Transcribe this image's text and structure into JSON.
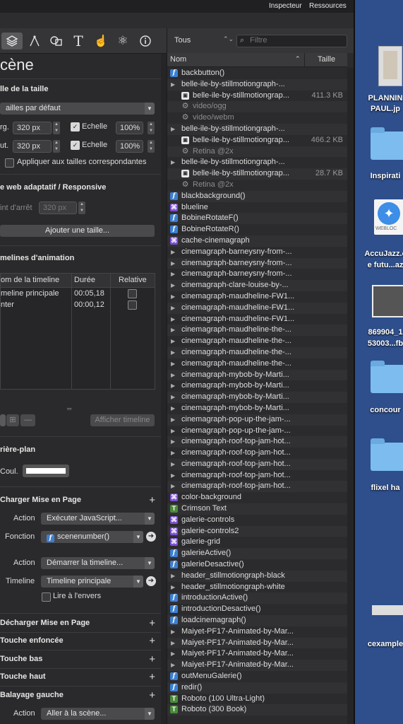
{
  "topbar": {
    "inspector": "Inspecteur",
    "resources": "Ressources"
  },
  "left": {
    "scene_title": "cène",
    "size_section": "lle de la taille",
    "sizes_default": "ailles par défaut",
    "width_label": "rg.",
    "width_value": "320 px",
    "height_label": "ut.",
    "height_value": "320 px",
    "scale_label": "Echelle",
    "scale_value1": "100%",
    "scale_value2": "100%",
    "apply_sizes": "Appliquer aux tailles correspondantes",
    "responsive_section": "e web adaptatif / Responsive",
    "breakpoint_label": "int d'arrêt",
    "breakpoint_value": "320 px",
    "add_size": "Ajouter une taille...",
    "timelines_section": "melines d'animation",
    "tl_cols": {
      "name": "om de la timeline",
      "duration": "Durée",
      "relative": "Relative"
    },
    "tl_rows": [
      {
        "name": "meline principale",
        "duration": "00:05,18"
      },
      {
        "name": "nter",
        "duration": "00:00,12"
      }
    ],
    "show_timeline": "Afficher timeline",
    "background_section": "rière-plan",
    "color_label": "Coul.",
    "load_page": "Charger Mise en Page",
    "action_label": "Action",
    "action1": "Exécuter JavaScript...",
    "function_label": "Fonction",
    "function_value": "scenenumber()",
    "action2": "Démarrer la timeline...",
    "timeline_label": "Timeline",
    "timeline_value": "Timeline principale",
    "reverse_label": "Lire à l'envers",
    "unload_page": "Décharger Mise en Page",
    "key_down": "Touche enfoncée",
    "key_bottom": "Touche bas",
    "key_top": "Touche haut",
    "swipe_left": "Balayage gauche",
    "action3": "Aller à la scène..."
  },
  "right": {
    "filter_dropdown": "Tous",
    "search_placeholder": "Filtre",
    "col_name": "Nom",
    "col_size": "Taille",
    "rows": [
      {
        "icon": "f",
        "name": "backbutton()",
        "indent": 0
      },
      {
        "icon": "tri",
        "name": "belle-ile-by-stillmotiongraph-...",
        "indent": 0
      },
      {
        "icon": "img",
        "name": "belle-ile-by-stillmotiongrap...",
        "size": "411.3 KB",
        "indent": 1
      },
      {
        "icon": "gear",
        "name": "video/ogg",
        "indent": 1,
        "dim": true
      },
      {
        "icon": "gear",
        "name": "video/webm",
        "indent": 1,
        "dim": true
      },
      {
        "icon": "tri",
        "name": "belle-ile-by-stillmotiongraph-...",
        "indent": 0
      },
      {
        "icon": "img",
        "name": "belle-ile-by-stillmotiongrap...",
        "size": "466.2 KB",
        "indent": 1
      },
      {
        "icon": "gear",
        "name": "Retina @2x",
        "indent": 1,
        "dim": true
      },
      {
        "icon": "tri",
        "name": "belle-ile-by-stillmotiongraph-...",
        "indent": 0
      },
      {
        "icon": "img",
        "name": "belle-ile-by-stillmotiongrap...",
        "size": "28.7 KB",
        "indent": 1
      },
      {
        "icon": "gear",
        "name": "Retina @2x",
        "indent": 1,
        "dim": true
      },
      {
        "icon": "f",
        "name": "blackbackground()",
        "indent": 0
      },
      {
        "icon": "c",
        "name": "blueline",
        "indent": 0
      },
      {
        "icon": "f",
        "name": "BobineRotateF()",
        "indent": 0
      },
      {
        "icon": "f",
        "name": "BobineRotateR()",
        "indent": 0
      },
      {
        "icon": "c",
        "name": "cache-cinemagraph",
        "indent": 0
      },
      {
        "icon": "tri",
        "name": "cinemagraph-barneysny-from-...",
        "indent": 0
      },
      {
        "icon": "tri",
        "name": "cinemagraph-barneysny-from-...",
        "indent": 0
      },
      {
        "icon": "tri",
        "name": "cinemagraph-barneysny-from-...",
        "indent": 0
      },
      {
        "icon": "tri",
        "name": "cinemagraph-clare-louise-by-...",
        "indent": 0
      },
      {
        "icon": "tri",
        "name": "cinemagraph-maudheline-FW1...",
        "indent": 0
      },
      {
        "icon": "tri",
        "name": "cinemagraph-maudheline-FW1...",
        "indent": 0
      },
      {
        "icon": "tri",
        "name": "cinemagraph-maudheline-FW1...",
        "indent": 0
      },
      {
        "icon": "tri",
        "name": "cinemagraph-maudheline-the-...",
        "indent": 0
      },
      {
        "icon": "tri",
        "name": "cinemagraph-maudheline-the-...",
        "indent": 0
      },
      {
        "icon": "tri",
        "name": "cinemagraph-maudheline-the-...",
        "indent": 0
      },
      {
        "icon": "tri",
        "name": "cinemagraph-maudheline-the-...",
        "indent": 0
      },
      {
        "icon": "tri",
        "name": "cinemagraph-mybob-by-Marti...",
        "indent": 0
      },
      {
        "icon": "tri",
        "name": "cinemagraph-mybob-by-Marti...",
        "indent": 0
      },
      {
        "icon": "tri",
        "name": "cinemagraph-mybob-by-Marti...",
        "indent": 0
      },
      {
        "icon": "tri",
        "name": "cinemagraph-mybob-by-Marti...",
        "indent": 0
      },
      {
        "icon": "tri",
        "name": "cinemagraph-pop-up-the-jam-...",
        "indent": 0
      },
      {
        "icon": "tri",
        "name": "cinemagraph-pop-up-the-jam-...",
        "indent": 0
      },
      {
        "icon": "tri",
        "name": "cinemagraph-roof-top-jam-hot...",
        "indent": 0
      },
      {
        "icon": "tri",
        "name": "cinemagraph-roof-top-jam-hot...",
        "indent": 0
      },
      {
        "icon": "tri",
        "name": "cinemagraph-roof-top-jam-hot...",
        "indent": 0
      },
      {
        "icon": "tri",
        "name": "cinemagraph-roof-top-jam-hot...",
        "indent": 0
      },
      {
        "icon": "tri",
        "name": "cinemagraph-roof-top-jam-hot...",
        "indent": 0
      },
      {
        "icon": "c",
        "name": "color-background",
        "indent": 0
      },
      {
        "icon": "t",
        "name": "Crimson Text",
        "indent": 0
      },
      {
        "icon": "c",
        "name": "galerie-controls",
        "indent": 0
      },
      {
        "icon": "c",
        "name": "galerie-controls2",
        "indent": 0
      },
      {
        "icon": "c",
        "name": "galerie-grid",
        "indent": 0
      },
      {
        "icon": "f",
        "name": "galerieActive()",
        "indent": 0
      },
      {
        "icon": "f",
        "name": "galerieDesactive()",
        "indent": 0
      },
      {
        "icon": "tri",
        "name": "header_stillmotiongraph-black",
        "indent": 0
      },
      {
        "icon": "tri",
        "name": "header_stillmotiongraph-white",
        "indent": 0
      },
      {
        "icon": "f",
        "name": "introductionActive()",
        "indent": 0
      },
      {
        "icon": "f",
        "name": "introductionDesactive()",
        "indent": 0
      },
      {
        "icon": "f",
        "name": "loadcinemagraph()",
        "indent": 0
      },
      {
        "icon": "tri",
        "name": "Maiyet-PF17-Animated-by-Mar...",
        "indent": 0
      },
      {
        "icon": "tri",
        "name": "Maiyet-PF17-Animated-by-Mar...",
        "indent": 0
      },
      {
        "icon": "tri",
        "name": "Maiyet-PF17-Animated-by-Mar...",
        "indent": 0
      },
      {
        "icon": "tri",
        "name": "Maiyet-PF17-Animated-by-Mar...",
        "indent": 0
      },
      {
        "icon": "f",
        "name": "outMenuGalerie()",
        "indent": 0
      },
      {
        "icon": "f",
        "name": "redir()",
        "indent": 0
      },
      {
        "icon": "t",
        "name": "Roboto (100 Ultra-Light)",
        "indent": 0
      },
      {
        "icon": "t",
        "name": "Roboto (300 Book)",
        "indent": 0
      }
    ]
  },
  "desktop": {
    "items": [
      {
        "kind": "doc",
        "label1": "PLANNIN",
        "label2": "PAUL.jp"
      },
      {
        "kind": "folder",
        "label1": "Inspirati",
        "label2": ""
      },
      {
        "kind": "webloc",
        "label1": "AccuJazz.c",
        "label2": "e futu...az",
        "badge": "WEBLOC"
      },
      {
        "kind": "photo",
        "label1": "869904_1",
        "label2": "53003...fb"
      },
      {
        "kind": "folder",
        "label1": "concour",
        "label2": ""
      },
      {
        "kind": "folder",
        "label1": "flixel ha",
        "label2": ""
      },
      {
        "kind": "thumb",
        "label1": "cexample",
        "label2": ""
      }
    ]
  }
}
